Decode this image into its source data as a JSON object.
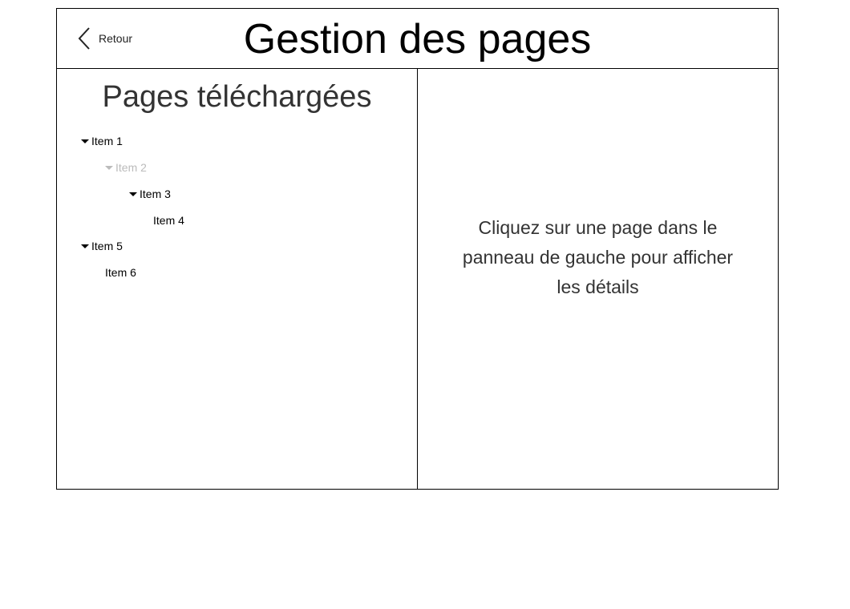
{
  "header": {
    "back_label": "Retour",
    "title": "Gestion des pages"
  },
  "left_panel": {
    "title": "Pages téléchargées",
    "items": [
      {
        "label": "Item 1",
        "expanded": true,
        "muted": false
      },
      {
        "label": "Item 2",
        "expanded": true,
        "muted": true
      },
      {
        "label": "Item 3",
        "expanded": true,
        "muted": false
      },
      {
        "label": "Item 4",
        "expanded": false,
        "muted": false
      },
      {
        "label": "Item 5",
        "expanded": true,
        "muted": false
      },
      {
        "label": "Item 6",
        "expanded": false,
        "muted": false
      }
    ]
  },
  "right_panel": {
    "placeholder": "Cliquez sur une page dans le panneau de gauche pour afficher les détails"
  },
  "icons": {
    "back": "chevron-left-icon",
    "expand": "caret-down-icon"
  },
  "colors": {
    "muted_text": "#bbbbbb",
    "border": "#000000"
  }
}
